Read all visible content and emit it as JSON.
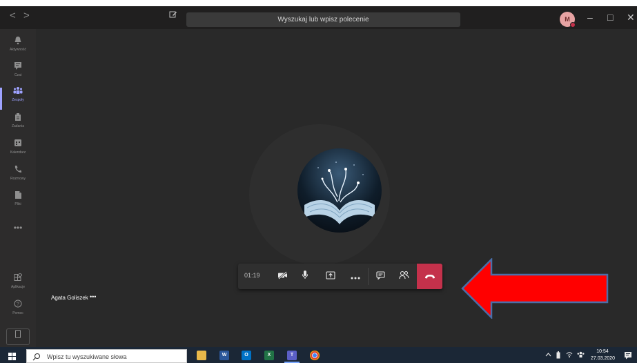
{
  "titlebar": {
    "back_label": "<",
    "forward_label": ">",
    "search_text": "Wyszukaj lub wpisz polecenie",
    "avatar_initial": "M",
    "minimize_label": "–",
    "maximize_label": "□",
    "close_label": "✕"
  },
  "rail": {
    "items": [
      {
        "label": "Aktywność",
        "icon": "bell-icon"
      },
      {
        "label": "Czat",
        "icon": "chat-icon"
      },
      {
        "label": "Zespoły",
        "icon": "teams-icon",
        "active": true
      },
      {
        "label": "Zadania",
        "icon": "assignments-icon"
      },
      {
        "label": "Kalendarz",
        "icon": "calendar-icon"
      },
      {
        "label": "Rozmowy",
        "icon": "phone-icon"
      },
      {
        "label": "Pliki",
        "icon": "file-icon"
      }
    ],
    "more_label": "•••",
    "bottom_items": [
      {
        "label": "Aplikacje",
        "icon": "apps-icon"
      },
      {
        "label": "Pomoc",
        "icon": "help-icon"
      }
    ]
  },
  "meeting": {
    "participant_name": "Agata Goliszek",
    "participant_more": "•••",
    "timer": "01:19"
  },
  "taskbar": {
    "search_placeholder": "Wpisz tu wyszukiwane słowa",
    "apps": [
      {
        "name": "file-explorer-icon",
        "label": ""
      },
      {
        "name": "word-icon",
        "label": "W"
      },
      {
        "name": "outlook-icon",
        "label": "O"
      },
      {
        "name": "excel-icon",
        "label": "X"
      },
      {
        "name": "teams-taskbar-icon",
        "label": "T"
      },
      {
        "name": "chrome-icon",
        "label": ""
      }
    ],
    "clock_time": "10:54",
    "clock_date": "27.03.2020"
  },
  "colors": {
    "accent": "#9ea2ff",
    "hangup": "#c4314b",
    "arrow": "#ff0000",
    "arrow_outline": "#4a6ea9"
  }
}
